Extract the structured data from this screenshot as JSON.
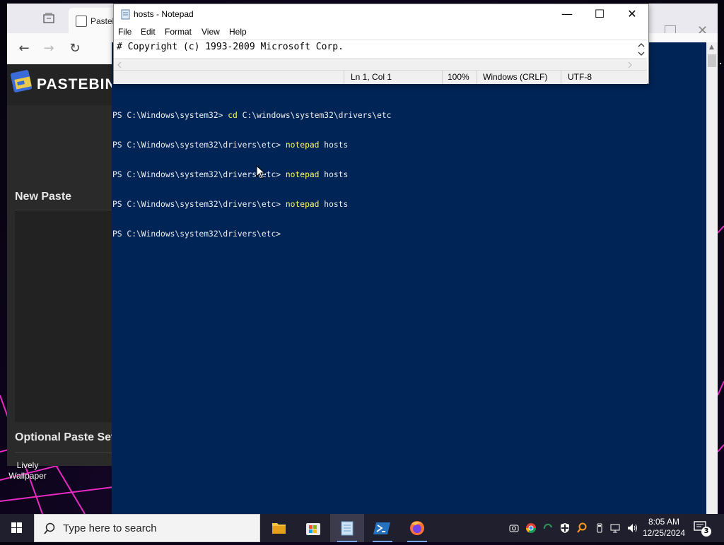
{
  "desktop": {
    "icon_label_line1": "Lively",
    "icon_label_line2": "Wallpaper"
  },
  "browser": {
    "tab_title": "Pasteb",
    "pastebin_brand": "PASTEBIN",
    "new_paste_heading": "New Paste",
    "optional_settings_heading": "Optional Paste Sett"
  },
  "notepad": {
    "title": "hosts - Notepad",
    "menu": [
      "File",
      "Edit",
      "Format",
      "View",
      "Help"
    ],
    "content": "# Copyright (c) 1993-2009 Microsoft Corp.",
    "status": {
      "position": "Ln 1, Col 1",
      "zoom": "100%",
      "line_ending": "Windows (CRLF)",
      "encoding": "UTF-8"
    }
  },
  "powershell": {
    "lines": [
      {
        "prompt": "PS C:\\Windows\\system32> ",
        "cmd": "cd",
        "args": " C:\\windows\\system32\\drivers\\etc"
      },
      {
        "prompt": "PS C:\\Windows\\system32\\drivers\\etc> ",
        "cmd": "notepad",
        "args": " hosts"
      },
      {
        "prompt": "PS C:\\Windows\\system32\\drivers\\etc> ",
        "cmd": "notepad",
        "args": " hosts"
      },
      {
        "prompt": "PS C:\\Windows\\system32\\drivers\\etc> ",
        "cmd": "notepad",
        "args": " hosts"
      },
      {
        "prompt": "PS C:\\Windows\\system32\\drivers\\etc> ",
        "cmd": "",
        "args": ""
      }
    ]
  },
  "taskbar": {
    "search_placeholder": "Type here to search",
    "time": "8:05 AM",
    "date": "12/25/2024",
    "notification_count": "3",
    "apps": [
      "file-explorer",
      "microsoft-store",
      "notepad",
      "powershell",
      "firefox"
    ]
  },
  "colors": {
    "ps_background": "#012456",
    "ps_command": "#ffff60",
    "taskbar": "#1f1f2e"
  }
}
